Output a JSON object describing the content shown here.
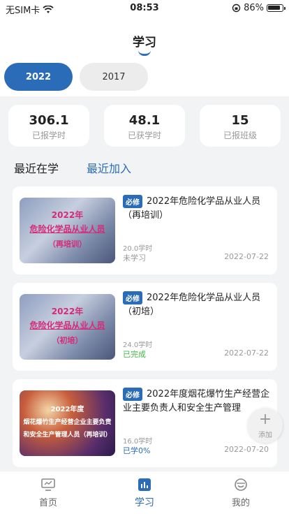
{
  "status_bar": {
    "carrier": "无SIM卡",
    "time": "08:53",
    "battery": "86%"
  },
  "header": {
    "title": "学习"
  },
  "year_tabs": [
    {
      "label": "2022",
      "active": true
    },
    {
      "label": "2017",
      "active": false
    }
  ],
  "stats": [
    {
      "value": "306.1",
      "label": "已报学时"
    },
    {
      "value": "48.1",
      "label": "已获学时"
    },
    {
      "value": "15",
      "label": "已报班级"
    }
  ],
  "section_tabs": {
    "recent_study": "最近在学",
    "recent_added": "最近加入"
  },
  "courses": [
    {
      "thumb": {
        "line1": "2022年",
        "line2": "危险化学品从业人员",
        "line3": "（再培训）"
      },
      "badge": "必修",
      "title": "2022年危险化学品从业人员（再培训）",
      "hours": "20.0学时",
      "progress": "未学习",
      "date": "2022-07-22"
    },
    {
      "thumb": {
        "line1": "2022年",
        "line2": "危险化学品从业人员",
        "line3": "（初培）"
      },
      "badge": "必修",
      "title": "2022年危险化学品从业人员（初培）",
      "hours": "24.0学时",
      "progress": "已完成",
      "date": "2022-07-22"
    },
    {
      "thumb": {
        "line1": "2022年度",
        "line2": "烟花爆竹生产经营企业主要负责",
        "line3": "和安全生产管理人员（再培训）"
      },
      "badge": "必修",
      "title": "2022年度烟花爆竹生产经营企业主要负责人和安全生产管理",
      "hours": "16.0学时",
      "progress": "已学0%",
      "date": "2022-07-20"
    }
  ],
  "fab": {
    "label": "添加"
  },
  "bottom_nav": [
    {
      "label": "首页",
      "icon": "monitor-icon"
    },
    {
      "label": "学习",
      "icon": "chart-bar-icon",
      "active": true
    },
    {
      "label": "我的",
      "icon": "user-face-icon"
    }
  ],
  "colors": {
    "accent": "#2b6cb8",
    "done": "#41b843"
  }
}
